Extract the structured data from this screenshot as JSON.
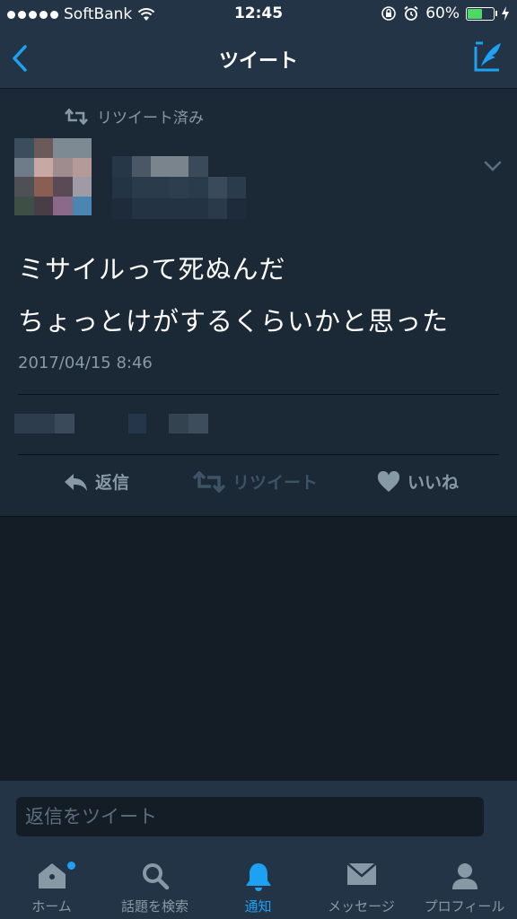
{
  "status_bar": {
    "carrier": "SoftBank",
    "time": "12:45",
    "battery_percent": "60%",
    "battery_level": 0.6
  },
  "nav": {
    "title": "ツイート"
  },
  "tweet": {
    "retweet_label": "リツイート済み",
    "text_lines": [
      "ミサイルって死ぬんだ",
      "ちょっとけがするくらいかと思った"
    ],
    "timestamp": "2017/04/15 8:46",
    "actions": {
      "reply": "返信",
      "retweet": "リツイート",
      "like": "いいね"
    }
  },
  "reply_bar": {
    "placeholder": "返信をツイート"
  },
  "tabs": [
    {
      "label": "ホーム",
      "icon": "home-icon",
      "active": false,
      "badge": true
    },
    {
      "label": "話題を検索",
      "icon": "search-icon",
      "active": false
    },
    {
      "label": "通知",
      "icon": "bell-icon",
      "active": true
    },
    {
      "label": "メッセージ",
      "icon": "mail-icon",
      "active": false
    },
    {
      "label": "プロフィール",
      "icon": "profile-icon",
      "active": false
    }
  ],
  "colors": {
    "background": "#141d26",
    "card": "#1b2836",
    "bar": "#243447",
    "accent": "#1da1f2",
    "muted": "#8899a6"
  }
}
